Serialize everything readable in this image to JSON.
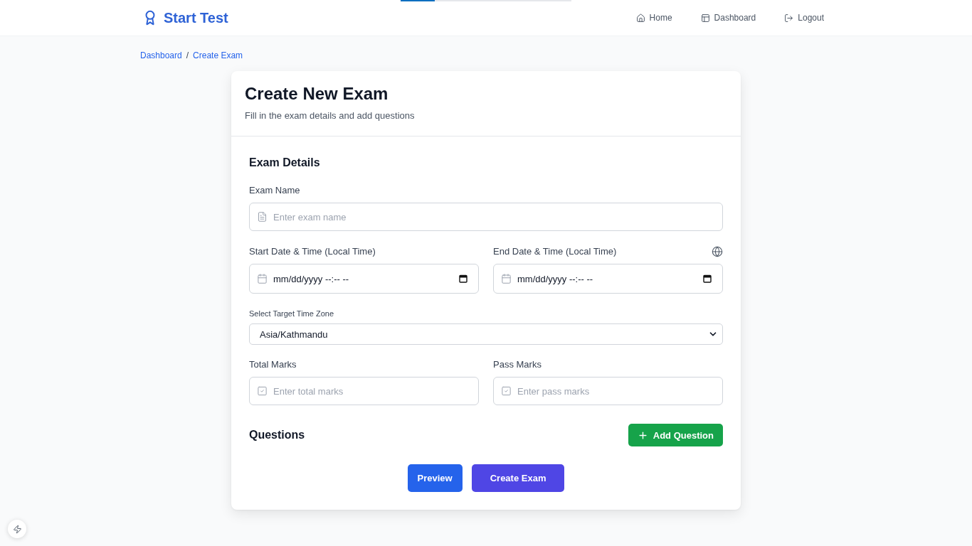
{
  "top_progress": {
    "level": 0.2
  },
  "header": {
    "brand": "Start Test",
    "nav": [
      {
        "label": "Home",
        "kind": "home"
      },
      {
        "label": "Dashboard",
        "kind": "dashboard"
      },
      {
        "label": "Logout",
        "kind": "logout"
      }
    ]
  },
  "breadcrumb": {
    "items": [
      {
        "label": "Dashboard"
      },
      {
        "label": "Create Exam"
      }
    ],
    "separator": "/"
  },
  "card": {
    "title": "Create New Exam",
    "subtitle": "Fill in the exam details and add questions",
    "section_title": "Exam Details",
    "exam_name": {
      "label": "Exam Name",
      "placeholder": "Enter exam name"
    },
    "start": {
      "label": "Start Date & Time (Local Time)",
      "placeholder": "mm/dd/yyyy --:-- --"
    },
    "end": {
      "label": "End Date & Time (Local Time)",
      "placeholder": "mm/dd/yyyy --:-- --"
    },
    "time_zone": {
      "label": "Select Target Time Zone",
      "value": "Asia/Kathmandu"
    },
    "total_marks": {
      "label": "Total Marks",
      "placeholder": "Enter total marks"
    },
    "pass_marks": {
      "label": "Pass Marks",
      "placeholder": "Enter pass marks"
    },
    "questions": {
      "title": "Questions",
      "add_button": "Add Question"
    },
    "actions": [
      {
        "label": "Preview",
        "kind": "preview"
      },
      {
        "label": "Create Exam",
        "kind": "create"
      }
    ]
  }
}
